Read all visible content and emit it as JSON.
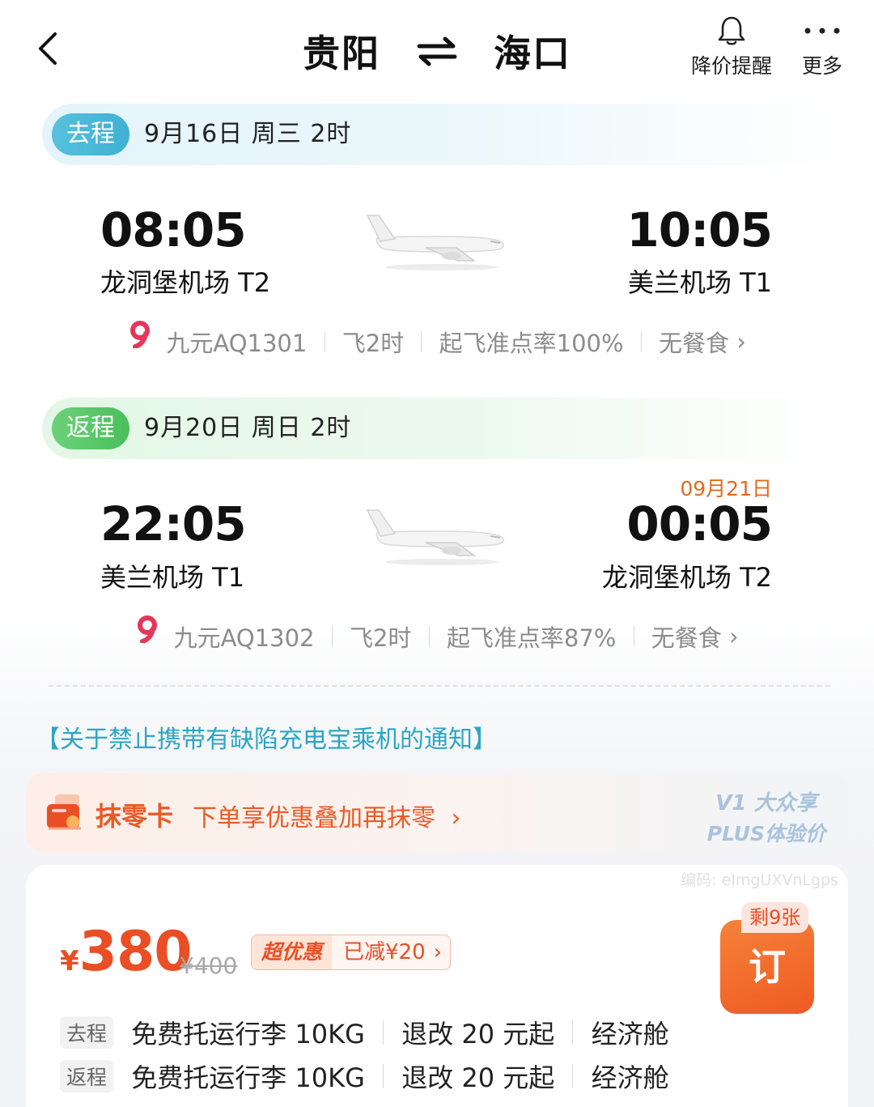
{
  "header": {
    "origin": "贵阳",
    "destination": "海口",
    "price_alert_label": "降价提醒",
    "more_label": "更多"
  },
  "outbound": {
    "tag": "去程",
    "info": "9月16日 周三  2时",
    "dep_time": "08:05",
    "dep_airport": "龙洞堡机场 T2",
    "arr_time": "10:05",
    "arr_airport": "美兰机场 T1",
    "flight_no": "九元AQ1301",
    "duration": "飞2时",
    "on_time": "起飞准点率100%",
    "meal": "无餐食"
  },
  "return": {
    "tag": "返程",
    "info": "9月20日 周日  2时",
    "dep_time": "22:05",
    "dep_airport": "美兰机场 T1",
    "arr_date": "09月21日",
    "arr_time": "00:05",
    "arr_airport": "龙洞堡机场 T2",
    "flight_no": "九元AQ1302",
    "duration": "飞2时",
    "on_time": "起飞准点率87%",
    "meal": "无餐食"
  },
  "notice": "【关于禁止携带有缺陷充电宝乘机的通知】",
  "promo": {
    "title": "抹零卡",
    "desc": "下单享优惠叠加再抹零",
    "badge_line1": "V1 大众享",
    "badge_line2": "PLUS体验价"
  },
  "price_card": {
    "watermark": "编码: eImgUXVnLgps",
    "currency": "¥",
    "price": "380",
    "original_price": "¥400",
    "discount_label": "超优惠",
    "discount_amount": "已减¥20",
    "remaining": "剩9张",
    "book_label": "订",
    "rules": [
      {
        "tag": "去程",
        "baggage": "免费托运行李 10KG",
        "change": "退改 20 元起",
        "cabin": "经济舱"
      },
      {
        "tag": "返程",
        "baggage": "免费托运行李 10KG",
        "change": "退改 20 元起",
        "cabin": "经济舱"
      }
    ]
  },
  "colors": {
    "accent_orange": "#ea4e25",
    "outbound_blue": "#3fb0d3",
    "return_green": "#49bf5d",
    "notice_blue": "#2aa6c6"
  }
}
